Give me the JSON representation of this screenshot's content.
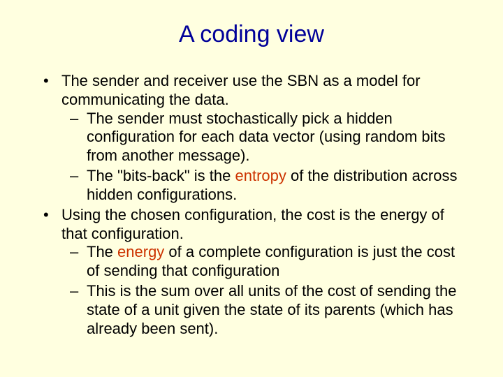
{
  "title": "A coding view",
  "b1": {
    "text": "The sender and receiver use the SBN as a model for communicating the data.",
    "s1": "The sender must stochastically pick a hidden configuration for each data vector (using random bits from another message).",
    "s2a": "The \"bits-back\" is the ",
    "s2_accent": "entropy",
    "s2b": " of the distribution across hidden configurations."
  },
  "b2": {
    "text": "Using the chosen configuration, the cost is the energy of that configuration.",
    "s1a": "The ",
    "s1_accent": "energy",
    "s1b": " of a complete configuration is just the cost of sending that configuration",
    "s2": "This is the sum over all units of the cost of sending the state of a unit given the state of its parents (which has already been sent)."
  }
}
